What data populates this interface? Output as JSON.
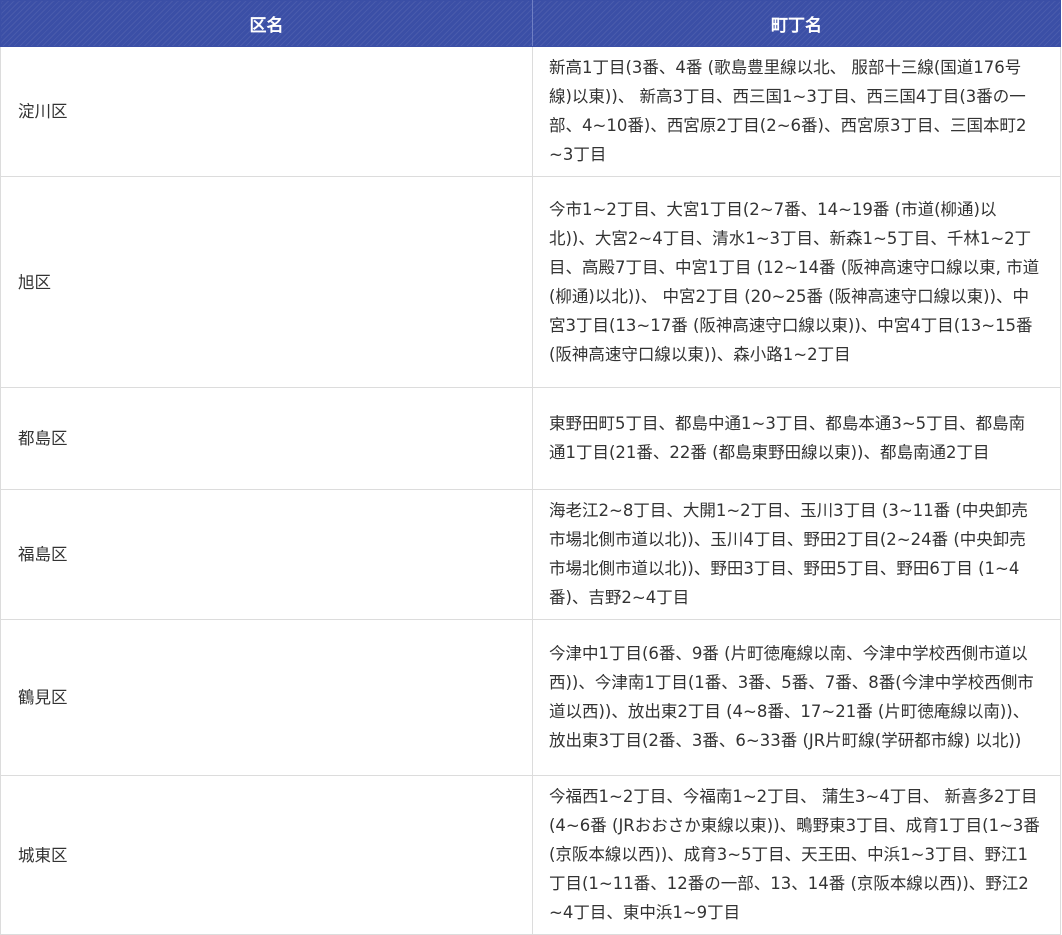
{
  "table": {
    "headers": {
      "ward": "区名",
      "towns": "町丁名"
    },
    "rows": [
      {
        "ward": "淀川区",
        "towns": "新高1丁目(3番、4番 (歌島豊里線以北、 服部十三線(国道176号線)以東))、 新高3丁目、西三国1~3丁目、西三国4丁目(3番の一部、4~10番)、西宮原2丁目(2~6番)、西宮原3丁目、三国本町2~3丁目"
      },
      {
        "ward": "旭区",
        "towns": "今市1~2丁目、大宮1丁目(2~7番、14~19番 (市道(柳通)以北))、大宮2~4丁目、清水1~3丁目、新森1~5丁目、千林1~2丁目、高殿7丁目、中宮1丁目 (12~14番 (阪神高速守口線以東, 市道(柳通)以北))、 中宮2丁目 (20~25番 (阪神高速守口線以東))、中宮3丁目(13~17番 (阪神高速守口線以東))、中宮4丁目(13~15番 (阪神高速守口線以東))、森小路1~2丁目"
      },
      {
        "ward": "都島区",
        "towns": "東野田町5丁目、都島中通1~3丁目、都島本通3~5丁目、都島南通1丁目(21番、22番 (都島東野田線以東))、都島南通2丁目"
      },
      {
        "ward": "福島区",
        "towns": "海老江2~8丁目、大開1~2丁目、玉川3丁目 (3~11番 (中央卸売市場北側市道以北))、玉川4丁目、野田2丁目(2~24番 (中央卸売市場北側市道以北))、野田3丁目、野田5丁目、野田6丁目 (1~4番)、吉野2~4丁目"
      },
      {
        "ward": "鶴見区",
        "towns": "今津中1丁目(6番、9番 (片町徳庵線以南、今津中学校西側市道以西))、今津南1丁目(1番、3番、5番、7番、8番(今津中学校西側市道以西))、放出東2丁目 (4~8番、17~21番 (片町徳庵線以南))、放出東3丁目(2番、3番、6~33番 (JR片町線(学研都市線) 以北))"
      },
      {
        "ward": "城東区",
        "towns": "今福西1~2丁目、今福南1~2丁目、 蒲生3~4丁目、 新喜多2丁目 (4~6番 (JRおおさか東線以東))、鴫野東3丁目、成育1丁目(1~3番 (京阪本線以西))、成育3~5丁目、天王田、中浜1~3丁目、野江1丁目(1~11番、12番の一部、13、14番 (京阪本線以西))、野江2~4丁目、東中浜1~9丁目"
      }
    ]
  }
}
